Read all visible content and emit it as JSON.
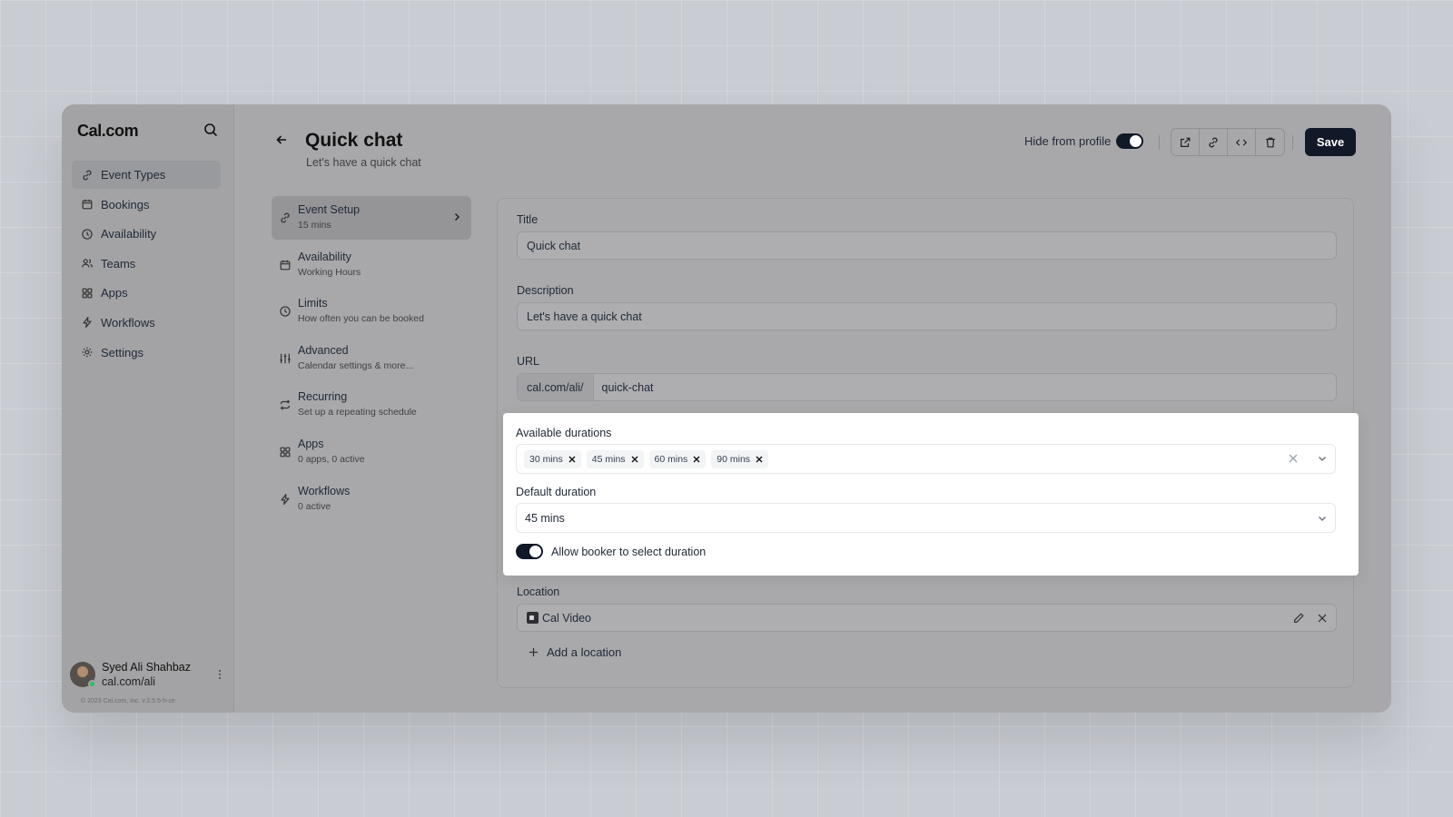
{
  "sidebar": {
    "logo": "Cal.com",
    "items": [
      {
        "label": "Event Types",
        "icon": "link-icon",
        "active": true
      },
      {
        "label": "Bookings",
        "icon": "calendar-icon"
      },
      {
        "label": "Availability",
        "icon": "clock-icon"
      },
      {
        "label": "Teams",
        "icon": "users-icon"
      },
      {
        "label": "Apps",
        "icon": "grid-icon"
      },
      {
        "label": "Workflows",
        "icon": "zap-icon"
      },
      {
        "label": "Settings",
        "icon": "gear-icon"
      }
    ],
    "user": {
      "name": "Syed Ali Shahbaz",
      "handle": "cal.com/ali"
    },
    "copyright": "© 2023 Cal.com, Inc. v.2.5.5-h-ce"
  },
  "header": {
    "title": "Quick chat",
    "subtitle": "Let's have a quick chat",
    "hide_from_profile_label": "Hide from profile",
    "hide_from_profile_on": true,
    "save_label": "Save"
  },
  "tabs": [
    {
      "title": "Event Setup",
      "subtitle": "15 mins",
      "icon": "link-icon",
      "active": true
    },
    {
      "title": "Availability",
      "subtitle": "Working Hours",
      "icon": "calendar-icon"
    },
    {
      "title": "Limits",
      "subtitle": "How often you can be booked",
      "icon": "clock-icon"
    },
    {
      "title": "Advanced",
      "subtitle": "Calendar settings & more...",
      "icon": "sliders-icon"
    },
    {
      "title": "Recurring",
      "subtitle": "Set up a repeating schedule",
      "icon": "repeat-icon"
    },
    {
      "title": "Apps",
      "subtitle": "0 apps, 0 active",
      "icon": "grid-icon"
    },
    {
      "title": "Workflows",
      "subtitle": "0 active",
      "icon": "zap-icon"
    }
  ],
  "form": {
    "title_label": "Title",
    "title_value": "Quick chat",
    "description_label": "Description",
    "description_value": "Let's have a quick chat",
    "url_label": "URL",
    "url_prefix": "cal.com/ali/",
    "url_value": "quick-chat",
    "durations_label": "Available durations",
    "durations": [
      "30 mins",
      "45 mins",
      "60 mins",
      "90 mins"
    ],
    "default_duration_label": "Default duration",
    "default_duration_value": "45 mins",
    "allow_booker_label": "Allow booker to select duration",
    "allow_booker_on": true,
    "location_label": "Location",
    "location_value": "Cal Video",
    "add_location_label": "Add a location"
  }
}
